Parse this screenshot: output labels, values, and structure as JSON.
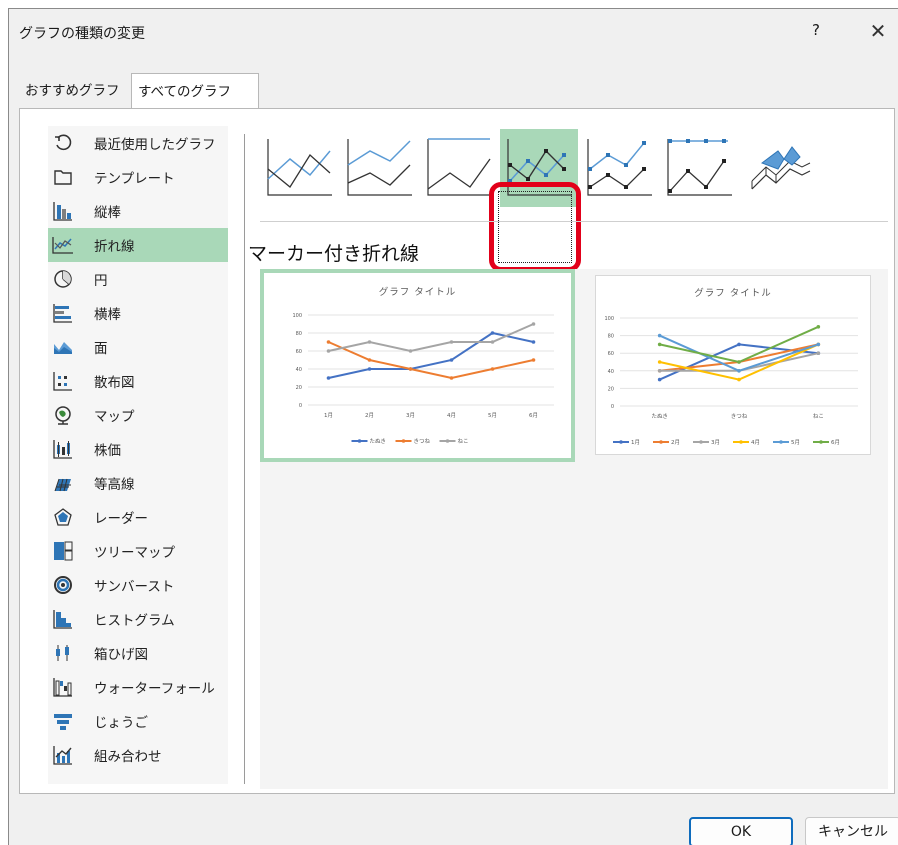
{
  "dialog": {
    "title": "グラフの種類の変更",
    "help": "?",
    "close": "✕"
  },
  "tabs": [
    {
      "label": "おすすめグラフ"
    },
    {
      "label": "すべてのグラフ"
    }
  ],
  "categories": [
    {
      "label": "最近使用したグラフ",
      "icon": "recent-icon"
    },
    {
      "label": "テンプレート",
      "icon": "folder-icon"
    },
    {
      "label": "縦棒",
      "icon": "column-chart-icon"
    },
    {
      "label": "折れ線",
      "icon": "line-chart-icon",
      "selected": true
    },
    {
      "label": "円",
      "icon": "pie-chart-icon"
    },
    {
      "label": "横棒",
      "icon": "bar-chart-icon"
    },
    {
      "label": "面",
      "icon": "area-chart-icon"
    },
    {
      "label": "散布図",
      "icon": "scatter-chart-icon"
    },
    {
      "label": "マップ",
      "icon": "map-chart-icon"
    },
    {
      "label": "株価",
      "icon": "stock-chart-icon"
    },
    {
      "label": "等高線",
      "icon": "surface-chart-icon"
    },
    {
      "label": "レーダー",
      "icon": "radar-chart-icon"
    },
    {
      "label": "ツリーマップ",
      "icon": "treemap-icon"
    },
    {
      "label": "サンバースト",
      "icon": "sunburst-icon"
    },
    {
      "label": "ヒストグラム",
      "icon": "histogram-icon"
    },
    {
      "label": "箱ひげ図",
      "icon": "box-whisker-icon"
    },
    {
      "label": "ウォーターフォール",
      "icon": "waterfall-icon"
    },
    {
      "label": "じょうご",
      "icon": "funnel-icon"
    },
    {
      "label": "組み合わせ",
      "icon": "combo-chart-icon"
    }
  ],
  "subtypes": [
    {
      "icon": "line-subtype-icon"
    },
    {
      "icon": "stacked-line-subtype-icon"
    },
    {
      "icon": "100-stacked-line-subtype-icon"
    },
    {
      "icon": "line-with-markers-subtype-icon",
      "selected": true
    },
    {
      "icon": "stacked-line-with-markers-subtype-icon"
    },
    {
      "icon": "100-stacked-line-with-markers-subtype-icon"
    },
    {
      "icon": "3d-line-subtype-icon"
    }
  ],
  "subtype_title": "マーカー付き折れ線",
  "colors": {
    "selection": "#a9d8b8",
    "highlight": "#e2001a",
    "series_blue": "#4472c4",
    "series_orange": "#ed7d31",
    "series_gray": "#a5a5a5",
    "series_yellow": "#ffc000",
    "series_lightblue": "#5b9bd5",
    "series_green": "#70ad47"
  },
  "chart_data": [
    {
      "type": "line",
      "title": "グラフ タイトル",
      "categories": [
        "1月",
        "2月",
        "3月",
        "4月",
        "5月",
        "6月"
      ],
      "series": [
        {
          "name": "たぬき",
          "values": [
            30,
            40,
            40,
            50,
            80,
            70
          ]
        },
        {
          "name": "きつね",
          "values": [
            70,
            50,
            40,
            30,
            40,
            50
          ]
        },
        {
          "name": "ねこ",
          "values": [
            60,
            70,
            60,
            70,
            70,
            90
          ]
        }
      ],
      "ylim": [
        0,
        100
      ],
      "yticks": [
        0,
        20,
        40,
        60,
        80,
        100
      ],
      "grid": true,
      "legend": "bottom"
    },
    {
      "type": "line",
      "title": "グラフ タイトル",
      "categories": [
        "たぬき",
        "きつね",
        "ねこ"
      ],
      "series": [
        {
          "name": "1月",
          "values": [
            30,
            70,
            60
          ]
        },
        {
          "name": "2月",
          "values": [
            40,
            50,
            70
          ]
        },
        {
          "name": "3月",
          "values": [
            40,
            40,
            60
          ]
        },
        {
          "name": "4月",
          "values": [
            50,
            30,
            70
          ]
        },
        {
          "name": "5月",
          "values": [
            80,
            40,
            70
          ]
        },
        {
          "name": "6月",
          "values": [
            70,
            50,
            90
          ]
        }
      ],
      "ylim": [
        0,
        100
      ],
      "yticks": [
        0,
        20,
        40,
        60,
        80,
        100
      ],
      "grid": true,
      "legend": "bottom"
    }
  ],
  "buttons": {
    "ok": "OK",
    "cancel": "キャンセル"
  }
}
